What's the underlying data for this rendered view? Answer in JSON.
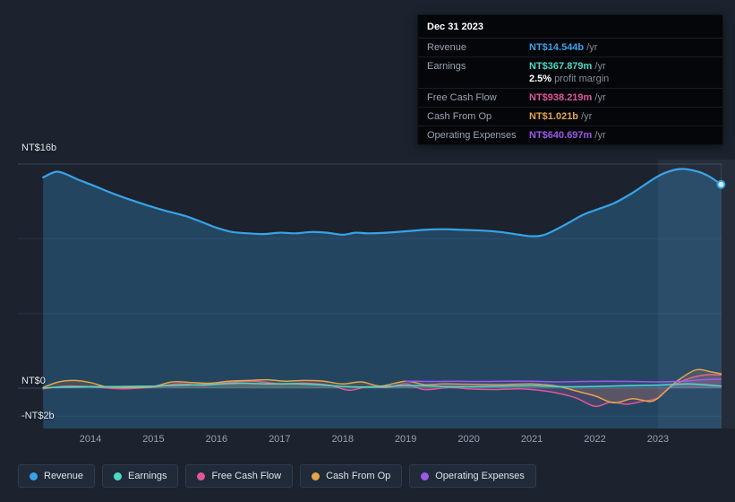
{
  "tooltip": {
    "date": "Dec 31 2023",
    "rows": [
      {
        "label": "Revenue",
        "value": "NT$14.544b",
        "suffix": " /yr",
        "color": "#3ba1e8"
      },
      {
        "label": "Earnings",
        "value": "NT$367.879m",
        "suffix": " /yr",
        "color": "#4fd8c4"
      },
      {
        "label": "Free Cash Flow",
        "value": "NT$938.219m",
        "suffix": " /yr",
        "color": "#e0569b"
      },
      {
        "label": "Cash From Op",
        "value": "NT$1.021b",
        "suffix": " /yr",
        "color": "#e3a44a"
      },
      {
        "label": "Operating Expenses",
        "value": "NT$640.697m",
        "suffix": " /yr",
        "color": "#9b59e8"
      }
    ],
    "profit_margin": {
      "value": "2.5%",
      "text": " profit margin"
    }
  },
  "legend": {
    "items": [
      {
        "label": "Revenue",
        "color": "#3ba1e8"
      },
      {
        "label": "Earnings",
        "color": "#4fd8c4"
      },
      {
        "label": "Free Cash Flow",
        "color": "#e0569b"
      },
      {
        "label": "Cash From Op",
        "color": "#e3a44a"
      },
      {
        "label": "Operating Expenses",
        "color": "#9b59e8"
      }
    ]
  },
  "chart_data": {
    "type": "area",
    "title": "Company financials history (NT$ billions)",
    "x_domain": [
      2013.25,
      2024.0
    ],
    "x_ticks": [
      2014,
      2015,
      2016,
      2017,
      2018,
      2019,
      2020,
      2021,
      2022,
      2023
    ],
    "y_axis": {
      "top_label": "NT$16b",
      "zero_label": "NT$0",
      "bottom_label": "-NT$2b",
      "units": "NT$ billions",
      "range": [
        -2.9,
        16.3
      ]
    },
    "gridlines": [
      {
        "value": 16,
        "major": true
      },
      {
        "value": 10.6667,
        "major": false
      },
      {
        "value": 5.3333,
        "major": false
      },
      {
        "value": 0,
        "major": true
      },
      {
        "value": -2,
        "major": false
      }
    ],
    "highlight_from_year": 2023.0,
    "legend_position": "bottom",
    "series": [
      {
        "name": "Revenue",
        "color": "#37a3e8",
        "width": 2.2,
        "fill": "bottom",
        "points": [
          [
            2013.25,
            15.05
          ],
          [
            2013.45,
            15.45
          ],
          [
            2013.6,
            15.3
          ],
          [
            2013.8,
            14.9
          ],
          [
            2014.0,
            14.55
          ],
          [
            2014.3,
            14.0
          ],
          [
            2014.6,
            13.5
          ],
          [
            2014.9,
            13.05
          ],
          [
            2015.2,
            12.65
          ],
          [
            2015.5,
            12.3
          ],
          [
            2015.8,
            11.8
          ],
          [
            2016.0,
            11.45
          ],
          [
            2016.25,
            11.15
          ],
          [
            2016.5,
            11.05
          ],
          [
            2016.75,
            11.0
          ],
          [
            2017.0,
            11.1
          ],
          [
            2017.25,
            11.05
          ],
          [
            2017.5,
            11.15
          ],
          [
            2017.75,
            11.1
          ],
          [
            2018.0,
            10.95
          ],
          [
            2018.2,
            11.1
          ],
          [
            2018.4,
            11.05
          ],
          [
            2018.7,
            11.1
          ],
          [
            2019.0,
            11.2
          ],
          [
            2019.3,
            11.3
          ],
          [
            2019.6,
            11.35
          ],
          [
            2019.9,
            11.3
          ],
          [
            2020.2,
            11.25
          ],
          [
            2020.5,
            11.15
          ],
          [
            2020.8,
            10.95
          ],
          [
            2021.0,
            10.85
          ],
          [
            2021.2,
            10.95
          ],
          [
            2021.5,
            11.6
          ],
          [
            2021.8,
            12.35
          ],
          [
            2022.0,
            12.7
          ],
          [
            2022.3,
            13.2
          ],
          [
            2022.6,
            13.95
          ],
          [
            2022.9,
            14.85
          ],
          [
            2023.1,
            15.35
          ],
          [
            2023.35,
            15.65
          ],
          [
            2023.6,
            15.5
          ],
          [
            2023.8,
            15.15
          ],
          [
            2024.0,
            14.544
          ]
        ]
      },
      {
        "name": "Free Cash Flow",
        "color": "#e0569b",
        "width": 1.5,
        "fill": "zero",
        "points": [
          [
            2013.25,
            -0.05
          ],
          [
            2013.6,
            0.15
          ],
          [
            2014.0,
            0.1
          ],
          [
            2014.5,
            -0.05
          ],
          [
            2015.0,
            0.08
          ],
          [
            2015.4,
            0.3
          ],
          [
            2015.8,
            0.2
          ],
          [
            2016.2,
            0.4
          ],
          [
            2016.6,
            0.5
          ],
          [
            2017.0,
            0.3
          ],
          [
            2017.4,
            0.35
          ],
          [
            2017.8,
            0.2
          ],
          [
            2018.1,
            -0.15
          ],
          [
            2018.4,
            0.1
          ],
          [
            2018.7,
            0.05
          ],
          [
            2019.0,
            0.3
          ],
          [
            2019.3,
            -0.1
          ],
          [
            2019.7,
            0.05
          ],
          [
            2020.0,
            -0.05
          ],
          [
            2020.4,
            -0.1
          ],
          [
            2020.8,
            -0.05
          ],
          [
            2021.1,
            -0.15
          ],
          [
            2021.4,
            -0.35
          ],
          [
            2021.7,
            -0.7
          ],
          [
            2022.0,
            -1.3
          ],
          [
            2022.25,
            -1.0
          ],
          [
            2022.5,
            -1.15
          ],
          [
            2022.75,
            -0.95
          ],
          [
            2023.0,
            -0.7
          ],
          [
            2023.2,
            0.1
          ],
          [
            2023.5,
            0.7
          ],
          [
            2023.75,
            0.95
          ],
          [
            2024.0,
            0.938
          ]
        ]
      },
      {
        "name": "Cash From Op",
        "color": "#e3a44a",
        "width": 1.5,
        "fill": "zero",
        "points": [
          [
            2013.25,
            0.05
          ],
          [
            2013.5,
            0.45
          ],
          [
            2013.75,
            0.55
          ],
          [
            2014.0,
            0.4
          ],
          [
            2014.25,
            0.1
          ],
          [
            2014.6,
            0.05
          ],
          [
            2015.0,
            0.12
          ],
          [
            2015.3,
            0.45
          ],
          [
            2015.6,
            0.4
          ],
          [
            2015.9,
            0.35
          ],
          [
            2016.2,
            0.5
          ],
          [
            2016.5,
            0.55
          ],
          [
            2016.8,
            0.6
          ],
          [
            2017.1,
            0.5
          ],
          [
            2017.4,
            0.55
          ],
          [
            2017.7,
            0.5
          ],
          [
            2018.0,
            0.3
          ],
          [
            2018.3,
            0.45
          ],
          [
            2018.6,
            0.15
          ],
          [
            2019.0,
            0.5
          ],
          [
            2019.3,
            0.25
          ],
          [
            2019.6,
            0.3
          ],
          [
            2020.0,
            0.28
          ],
          [
            2020.5,
            0.25
          ],
          [
            2021.0,
            0.3
          ],
          [
            2021.4,
            0.15
          ],
          [
            2021.7,
            -0.2
          ],
          [
            2022.0,
            -0.55
          ],
          [
            2022.3,
            -1.05
          ],
          [
            2022.6,
            -0.75
          ],
          [
            2022.9,
            -0.95
          ],
          [
            2023.1,
            -0.3
          ],
          [
            2023.3,
            0.5
          ],
          [
            2023.6,
            1.3
          ],
          [
            2023.85,
            1.15
          ],
          [
            2024.0,
            1.021
          ]
        ]
      },
      {
        "name": "Operating Expenses",
        "color": "#9b59e8",
        "width": 1.5,
        "fill": "zero",
        "points": [
          [
            2019.0,
            0.5
          ],
          [
            2019.4,
            0.48
          ],
          [
            2019.8,
            0.5
          ],
          [
            2020.2,
            0.48
          ],
          [
            2020.6,
            0.5
          ],
          [
            2021.0,
            0.5
          ],
          [
            2021.4,
            0.45
          ],
          [
            2021.8,
            0.48
          ],
          [
            2022.2,
            0.5
          ],
          [
            2022.6,
            0.48
          ],
          [
            2023.0,
            0.45
          ],
          [
            2023.4,
            0.5
          ],
          [
            2023.7,
            0.6
          ],
          [
            2024.0,
            0.641
          ]
        ]
      },
      {
        "name": "Earnings",
        "color": "#4fd8c4",
        "width": 1.5,
        "fill": "zero",
        "points": [
          [
            2013.25,
            0.02
          ],
          [
            2013.6,
            0.08
          ],
          [
            2014.0,
            0.1
          ],
          [
            2014.5,
            0.12
          ],
          [
            2015.0,
            0.15
          ],
          [
            2015.5,
            0.22
          ],
          [
            2016.0,
            0.28
          ],
          [
            2016.4,
            0.35
          ],
          [
            2016.8,
            0.3
          ],
          [
            2017.2,
            0.32
          ],
          [
            2017.6,
            0.25
          ],
          [
            2018.0,
            0.12
          ],
          [
            2018.4,
            0.08
          ],
          [
            2018.8,
            0.15
          ],
          [
            2019.2,
            0.18
          ],
          [
            2019.6,
            0.12
          ],
          [
            2020.0,
            0.1
          ],
          [
            2020.5,
            0.14
          ],
          [
            2021.0,
            0.18
          ],
          [
            2021.5,
            0.1
          ],
          [
            2022.0,
            0.12
          ],
          [
            2022.5,
            0.18
          ],
          [
            2023.0,
            0.22
          ],
          [
            2023.5,
            0.3
          ],
          [
            2024.0,
            0.14544
          ]
        ]
      }
    ],
    "end_marker": {
      "series": "Revenue",
      "year": 2024.0,
      "value": 14.544
    }
  }
}
